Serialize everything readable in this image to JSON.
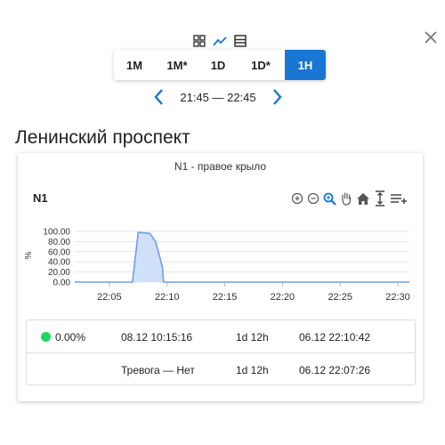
{
  "window": {
    "close_icon": "close-icon"
  },
  "view_switcher": {
    "icons": [
      "grid-icon",
      "line-chart-icon",
      "table-icon"
    ],
    "active": "line-chart-icon",
    "accent": "#1976d2"
  },
  "range_buttons": [
    {
      "label": "1M",
      "active": false
    },
    {
      "label": "1M*",
      "active": false
    },
    {
      "label": "1D",
      "active": false
    },
    {
      "label": "1D*",
      "active": false
    },
    {
      "label": "1H",
      "active": true
    }
  ],
  "time_nav": {
    "range": "21:45 — 22:45",
    "prev_icon": "chevron-left-icon",
    "next_icon": "chevron-right-icon"
  },
  "station": {
    "title": "Ленинский проспект"
  },
  "card": {
    "subtitle": "N1 - правое крыло",
    "series_label": "N1",
    "toolbar_icons": [
      "zoom-in-icon",
      "zoom-out-icon",
      "zoom-select-icon",
      "pan-hand-icon",
      "home-icon",
      "reset-icon",
      "menu-icon"
    ]
  },
  "chart_data": {
    "type": "area",
    "title": "",
    "xlabel": "",
    "ylabel": "%",
    "ylim": [
      0,
      100
    ],
    "yticks": [
      "100.00",
      "80.00",
      "60.00",
      "40.00",
      "20.00",
      "0.00"
    ],
    "xticks": [
      "22:05",
      "22:10",
      "22:15",
      "22:20",
      "22:25",
      "22:30"
    ],
    "xlim": [
      "22:02",
      "22:31"
    ],
    "grid": true,
    "color": "#6e9ee8",
    "fill": "#cfe0f8",
    "series": [
      {
        "x": [
          "22:02",
          "22:05",
          "22:07",
          "22:07.5",
          "22:08.5",
          "22:09",
          "22:09.6",
          "22:09.7",
          "22:31"
        ],
        "values": [
          0,
          0,
          0,
          98,
          96,
          80,
          30,
          0,
          0
        ]
      }
    ]
  },
  "info_table": {
    "rows": [
      {
        "status_color": "#1ed760",
        "value": "0.00%",
        "time": "08.12 10:15:16",
        "duration": "1d 12h",
        "last": "06.12 22:10:42"
      },
      {
        "status_color": "",
        "value": "Тревога — Нет",
        "time": "",
        "duration": "1d 12h",
        "last": "06.12 22:07:26"
      }
    ]
  }
}
